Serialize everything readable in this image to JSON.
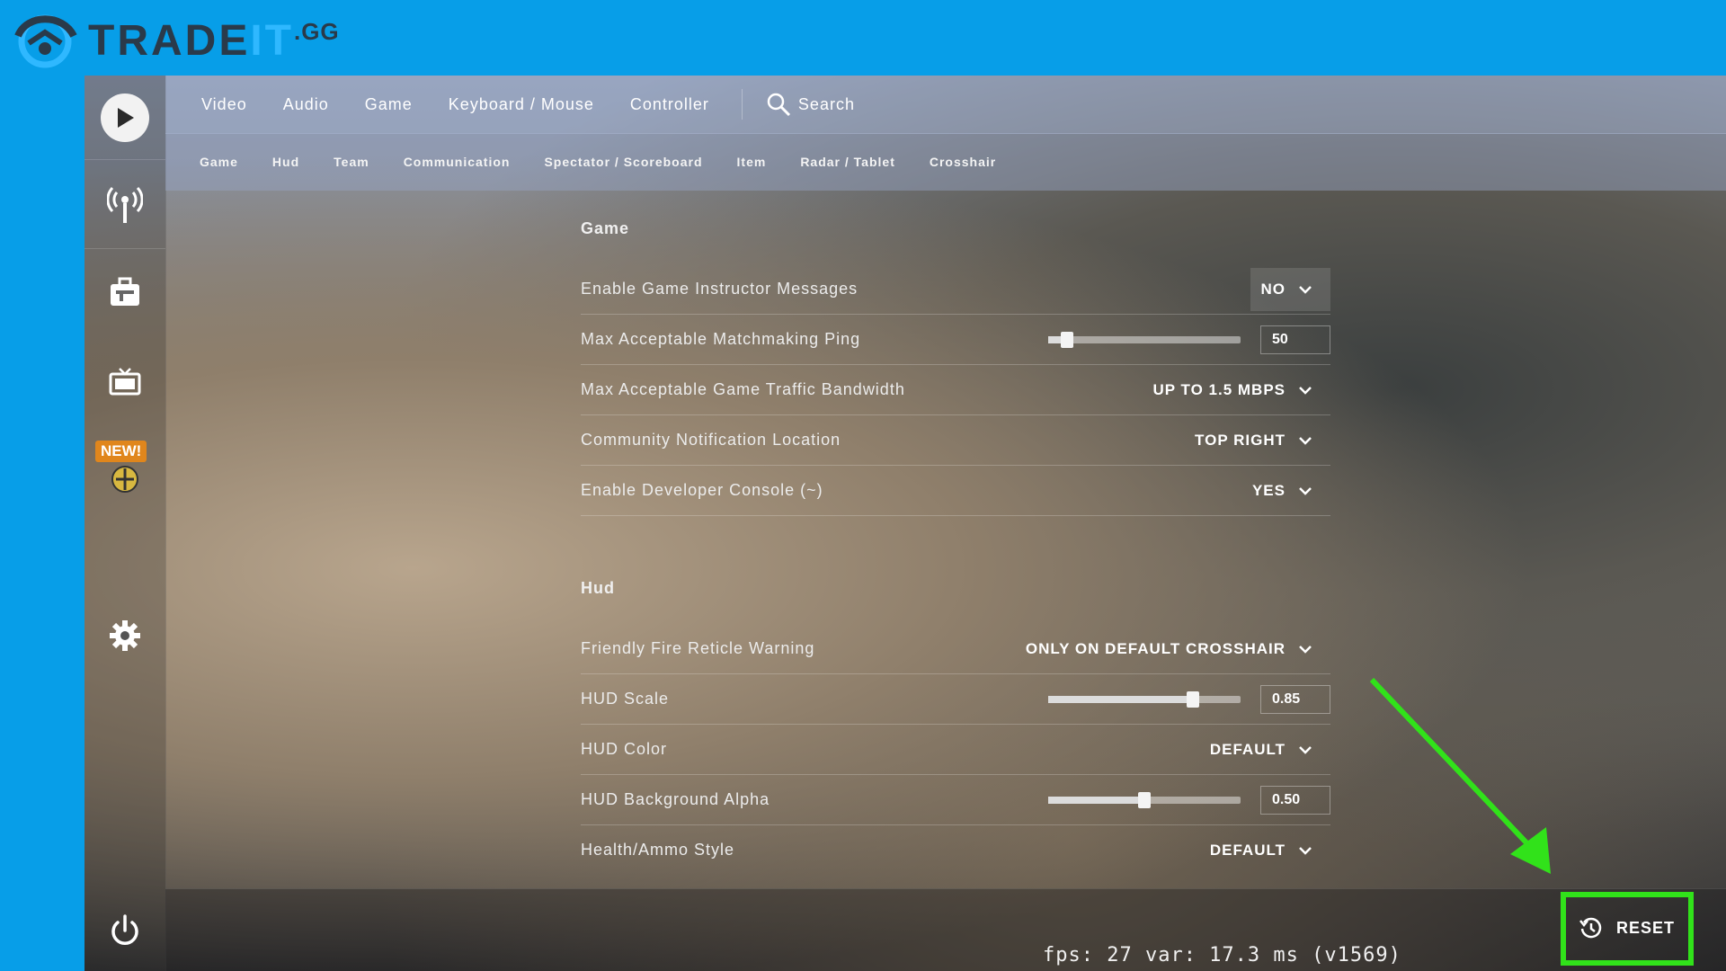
{
  "logo": {
    "part1": "TRADE",
    "part2": "IT",
    "suffix": ".GG"
  },
  "sidebar": {
    "items": [
      {
        "name": "play-icon"
      },
      {
        "name": "broadcast-icon"
      },
      {
        "name": "inventory-icon"
      },
      {
        "name": "tv-icon"
      },
      {
        "name": "operation-icon"
      },
      {
        "name": "gear-icon"
      },
      {
        "name": "power-icon"
      }
    ],
    "new_badge": "NEW!"
  },
  "topnav": {
    "tabs": [
      "Video",
      "Audio",
      "Game",
      "Keyboard / Mouse",
      "Controller"
    ],
    "search_label": "Search"
  },
  "subnav": {
    "tabs": [
      "Game",
      "Hud",
      "Team",
      "Communication",
      "Spectator / Scoreboard",
      "Item",
      "Radar / Tablet",
      "Crosshair"
    ]
  },
  "sections": {
    "game": {
      "title": "Game",
      "rows": [
        {
          "label": "Enable Game Instructor Messages",
          "value": "NO"
        },
        {
          "label": "Max Acceptable Matchmaking Ping",
          "value": "50",
          "level": 0.1
        },
        {
          "label": "Max Acceptable Game Traffic Bandwidth",
          "value": "UP TO 1.5 MBPS"
        },
        {
          "label": "Community Notification Location",
          "value": "TOP RIGHT"
        },
        {
          "label": "Enable Developer Console (~)",
          "value": "YES"
        }
      ]
    },
    "hud": {
      "title": "Hud",
      "rows": [
        {
          "label": "Friendly Fire Reticle Warning",
          "value": "ONLY ON DEFAULT CROSSHAIR"
        },
        {
          "label": "HUD Scale",
          "value": "0.85",
          "level": 0.75
        },
        {
          "label": "HUD Color",
          "value": "DEFAULT"
        },
        {
          "label": "HUD Background Alpha",
          "value": "0.50",
          "level": 0.5
        },
        {
          "label": "Health/Ammo Style",
          "value": "DEFAULT"
        }
      ]
    }
  },
  "footer": {
    "fps_text": "fps:    27 var: 17.3 ms (v1569)",
    "reset_label": "RESET"
  },
  "colors": {
    "background": "#079ee8",
    "highlight": "#31e21a",
    "badge": "#e0861c"
  }
}
